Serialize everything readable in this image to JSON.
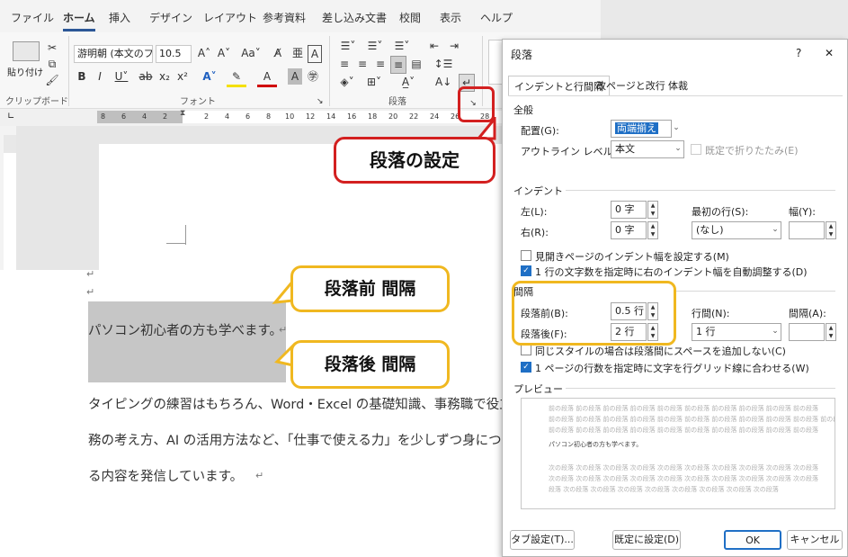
{
  "ribbon": {
    "menu": [
      "ファイル",
      "ホーム",
      "挿入",
      "デザイン",
      "レイアウト",
      "参考資料",
      "差し込み文書",
      "校閲",
      "表示",
      "ヘルプ"
    ],
    "font_name": "游明朝 (本文のフ:",
    "font_size": "10.5",
    "paste_label": "貼り付け",
    "groups": {
      "clipboard": "クリップボード",
      "font": "フォント",
      "paragraph": "段落"
    }
  },
  "ruler": {
    "left_numbers": [
      "8",
      "6",
      "4",
      "2"
    ],
    "right_numbers": [
      "2",
      "4",
      "6",
      "8",
      "10",
      "12",
      "14",
      "16",
      "18",
      "20",
      "22",
      "24",
      "26",
      "28"
    ]
  },
  "document": {
    "para1": "パソコン初心者の方も学べます。",
    "para2_line1": "タイピングの練習はもちろん、Word・Excel の基礎知識、事務職で役立つ",
    "para2_line2": "務の考え方、AI の活用方法など、「仕事で使える力」を少しずつ身につけら",
    "para2_line3": "る内容を発信しています。",
    "return_mark": "↵"
  },
  "callouts": {
    "paragraph_settings": "段落の設定",
    "space_before": "段落前  間隔",
    "space_after": "段落後  間隔"
  },
  "dialog": {
    "title": "段落",
    "help": "?",
    "close": "✕",
    "tabs": [
      "インデントと行間隔",
      "改ページと改行",
      "体裁"
    ],
    "general": {
      "section": "全般",
      "alignment_label": "配置(G):",
      "alignment_value": "両端揃え",
      "outline_label": "アウトライン レベル(O):",
      "outline_value": "本文",
      "collapse_label": "既定で折りたたみ(E)"
    },
    "indent": {
      "section": "インデント",
      "left_label": "左(L):",
      "left_value": "0 字",
      "right_label": "右(R):",
      "right_value": "0 字",
      "first_line_label": "最初の行(S):",
      "first_line_value": "(なし)",
      "width_label": "幅(Y):",
      "mirror_label": "見開きページのインデント幅を設定する(M)",
      "auto_adjust_label": "1 行の文字数を指定時に右のインデント幅を自動調整する(D)"
    },
    "spacing": {
      "section": "間隔",
      "before_label": "段落前(B):",
      "before_value": "0.5 行",
      "after_label": "段落後(F):",
      "after_value": "2 行",
      "line_spacing_label": "行間(N):",
      "line_spacing_value": "1 行",
      "at_label": "間隔(A):",
      "same_style_label": "同じスタイルの場合は段落間にスペースを追加しない(C)",
      "grid_label": "1 ページの行数を指定時に文字を行グリッド線に合わせる(W)"
    },
    "preview": {
      "section": "プレビュー",
      "prev_line": "前の段落 前の段落 前の段落 前の段落 前の段落 前の段落 前の段落 前の段落 前の段落 前の段落",
      "prev_line_short": "前の段落 前の段落 前の段落 前の段落 前の段落 前の段落 前の段落 前の段落 前の段落 前の段落 前の段落",
      "prev_last": "落",
      "sample": "パソコン初心者の方も学べます。",
      "next_line": "次の段落 次の段落 次の段落 次の段落 次の段落 次の段落 次の段落 次の段落 次の段落 次の段落",
      "next_last": "段落 次の段落 次の段落 次の段落 次の段落 次の段落 次の段落 次の段落 次の段落"
    },
    "buttons": {
      "tabs": "タブ設定(T)...",
      "set_default": "既定に設定(D)",
      "ok": "OK",
      "cancel": "キャンセル"
    }
  },
  "colors": {
    "callout_red": "#d32020",
    "callout_yellow": "#f0b820",
    "checkbox_blue": "#1f6fc5"
  }
}
